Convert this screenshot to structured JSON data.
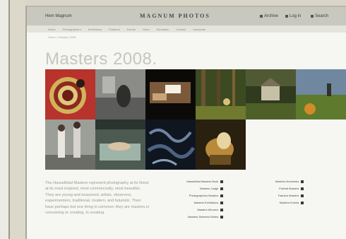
{
  "topbar": {
    "home_label": "Hem Magnum",
    "brand": "MAGNUM PHOTOS",
    "util": [
      "Archive",
      "Log in",
      "Search"
    ]
  },
  "nav": [
    "About",
    "Photographers",
    "Exhibitions",
    "Features",
    "Events",
    "Store",
    "Education",
    "Contact",
    "Subscribe"
  ],
  "breadcrumb": "Home > Masters 2008",
  "page_title": "Masters 2008.",
  "body_text": "The Hasselblad Masters represent photography at its finest at its most inspired, most commercially, most beautiful. They are young and seasoned, artists, observers, experimenters, traditional, modern, and futuristic. Their have perhaps but one thing in common: they are masters in conceiving or creating, in creating.",
  "links_col1": [
    "Hasselblad Masters Book",
    "Masters Judge",
    "Photographers Masters",
    "Masters Exhibitions",
    "Masters Winners",
    "Masters Selected Works"
  ],
  "links_col2": [
    "Masters Nominees",
    "Portrait Masters",
    "Fashion Masters",
    "Masters Events"
  ]
}
